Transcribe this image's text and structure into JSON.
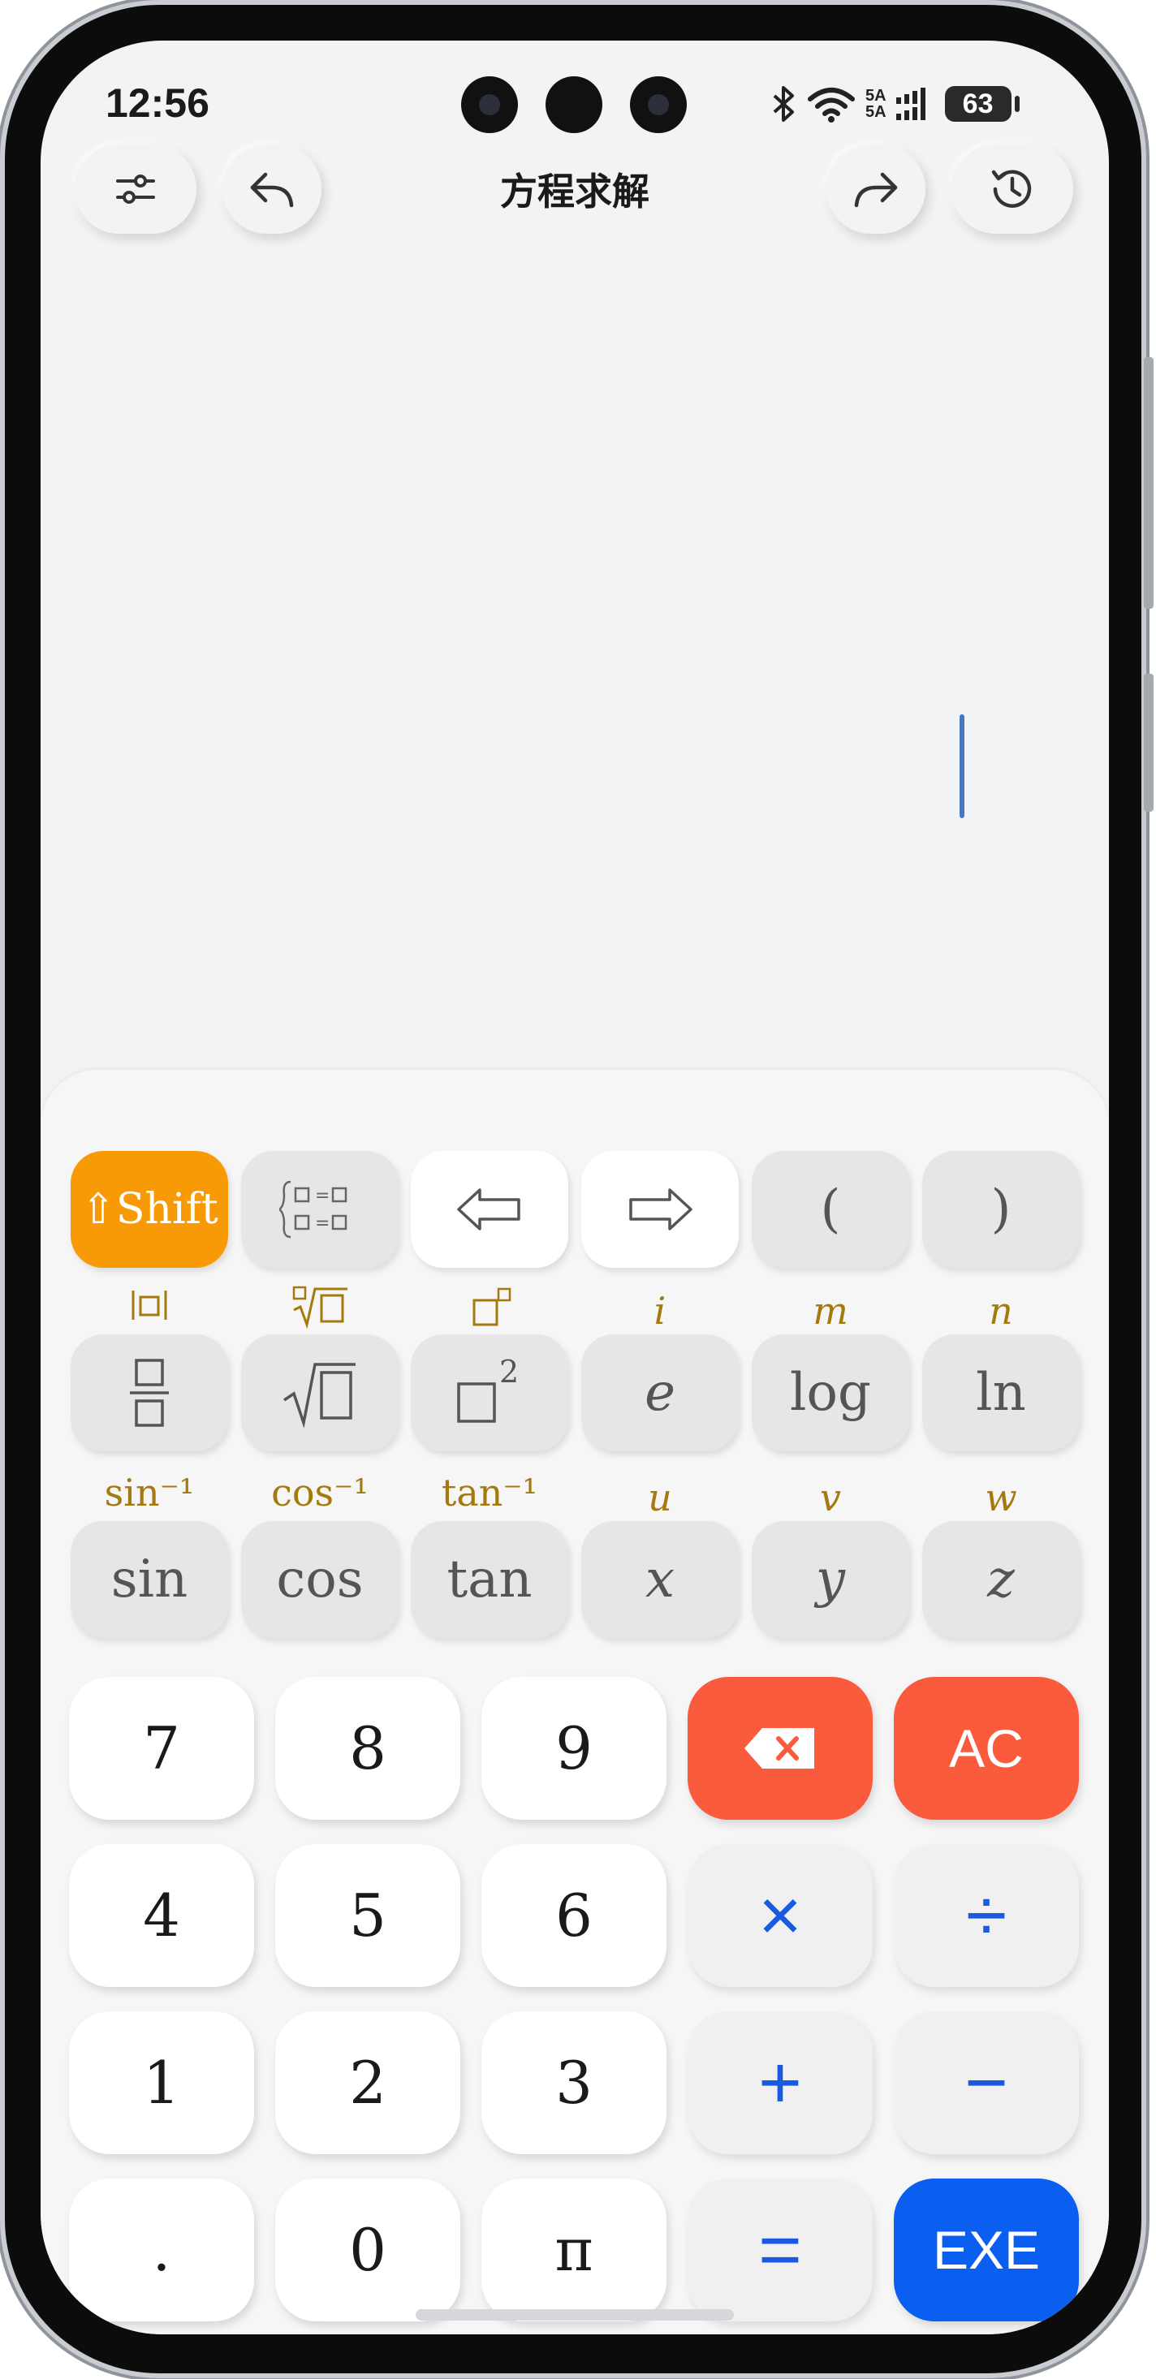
{
  "status_bar": {
    "time": "12:56",
    "battery": "63",
    "net1": "5A",
    "net2": "5A"
  },
  "header": {
    "title": "方程求解"
  },
  "keys": {
    "shift": "⇧Shift",
    "paren_open": "(",
    "paren_close": ")",
    "log": "log",
    "ln": "ln",
    "e": "e",
    "sin": "sin",
    "cos": "cos",
    "tan": "tan",
    "x": "x",
    "y": "y",
    "z": "z",
    "n7": "7",
    "n8": "8",
    "n9": "9",
    "n4": "4",
    "n5": "5",
    "n6": "6",
    "n1": "1",
    "n2": "2",
    "n3": "3",
    "dot": ".",
    "n0": "0",
    "pi": "π",
    "ac": "AC",
    "multiply": "×",
    "divide": "÷",
    "plus": "+",
    "minus": "−",
    "equals": "=",
    "exe": "EXE"
  },
  "secondary": {
    "i": "i",
    "m": "m",
    "n": "n",
    "asin": "sin⁻¹",
    "acos": "cos⁻¹",
    "atan": "tan⁻¹",
    "u": "u",
    "v": "v",
    "w": "w"
  },
  "colors": {
    "accent_orange": "#f89a06",
    "danger": "#fb5b3d",
    "primary": "#0b5ff0",
    "secondary_label": "#a47a0e"
  }
}
